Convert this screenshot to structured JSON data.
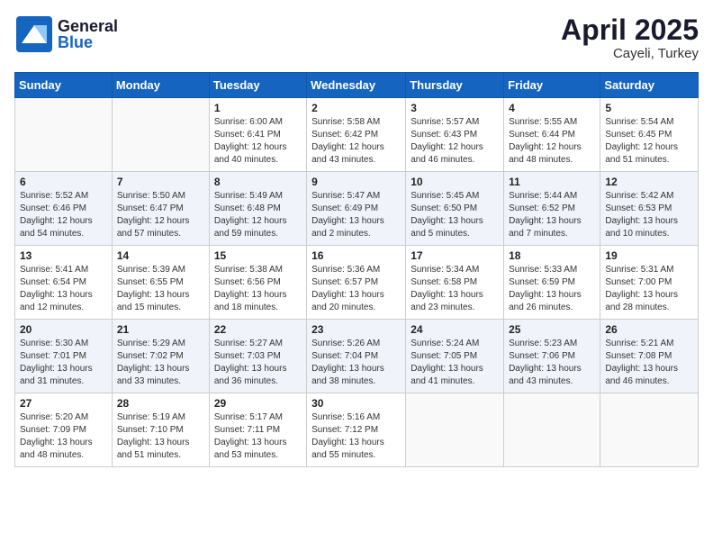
{
  "header": {
    "logo_general": "General",
    "logo_blue": "Blue",
    "month_year": "April 2025",
    "location": "Cayeli, Turkey"
  },
  "weekdays": [
    "Sunday",
    "Monday",
    "Tuesday",
    "Wednesday",
    "Thursday",
    "Friday",
    "Saturday"
  ],
  "weeks": [
    [
      {
        "day": "",
        "info": ""
      },
      {
        "day": "",
        "info": ""
      },
      {
        "day": "1",
        "info": "Sunrise: 6:00 AM\nSunset: 6:41 PM\nDaylight: 12 hours and 40 minutes."
      },
      {
        "day": "2",
        "info": "Sunrise: 5:58 AM\nSunset: 6:42 PM\nDaylight: 12 hours and 43 minutes."
      },
      {
        "day": "3",
        "info": "Sunrise: 5:57 AM\nSunset: 6:43 PM\nDaylight: 12 hours and 46 minutes."
      },
      {
        "day": "4",
        "info": "Sunrise: 5:55 AM\nSunset: 6:44 PM\nDaylight: 12 hours and 48 minutes."
      },
      {
        "day": "5",
        "info": "Sunrise: 5:54 AM\nSunset: 6:45 PM\nDaylight: 12 hours and 51 minutes."
      }
    ],
    [
      {
        "day": "6",
        "info": "Sunrise: 5:52 AM\nSunset: 6:46 PM\nDaylight: 12 hours and 54 minutes."
      },
      {
        "day": "7",
        "info": "Sunrise: 5:50 AM\nSunset: 6:47 PM\nDaylight: 12 hours and 57 minutes."
      },
      {
        "day": "8",
        "info": "Sunrise: 5:49 AM\nSunset: 6:48 PM\nDaylight: 12 hours and 59 minutes."
      },
      {
        "day": "9",
        "info": "Sunrise: 5:47 AM\nSunset: 6:49 PM\nDaylight: 13 hours and 2 minutes."
      },
      {
        "day": "10",
        "info": "Sunrise: 5:45 AM\nSunset: 6:50 PM\nDaylight: 13 hours and 5 minutes."
      },
      {
        "day": "11",
        "info": "Sunrise: 5:44 AM\nSunset: 6:52 PM\nDaylight: 13 hours and 7 minutes."
      },
      {
        "day": "12",
        "info": "Sunrise: 5:42 AM\nSunset: 6:53 PM\nDaylight: 13 hours and 10 minutes."
      }
    ],
    [
      {
        "day": "13",
        "info": "Sunrise: 5:41 AM\nSunset: 6:54 PM\nDaylight: 13 hours and 12 minutes."
      },
      {
        "day": "14",
        "info": "Sunrise: 5:39 AM\nSunset: 6:55 PM\nDaylight: 13 hours and 15 minutes."
      },
      {
        "day": "15",
        "info": "Sunrise: 5:38 AM\nSunset: 6:56 PM\nDaylight: 13 hours and 18 minutes."
      },
      {
        "day": "16",
        "info": "Sunrise: 5:36 AM\nSunset: 6:57 PM\nDaylight: 13 hours and 20 minutes."
      },
      {
        "day": "17",
        "info": "Sunrise: 5:34 AM\nSunset: 6:58 PM\nDaylight: 13 hours and 23 minutes."
      },
      {
        "day": "18",
        "info": "Sunrise: 5:33 AM\nSunset: 6:59 PM\nDaylight: 13 hours and 26 minutes."
      },
      {
        "day": "19",
        "info": "Sunrise: 5:31 AM\nSunset: 7:00 PM\nDaylight: 13 hours and 28 minutes."
      }
    ],
    [
      {
        "day": "20",
        "info": "Sunrise: 5:30 AM\nSunset: 7:01 PM\nDaylight: 13 hours and 31 minutes."
      },
      {
        "day": "21",
        "info": "Sunrise: 5:29 AM\nSunset: 7:02 PM\nDaylight: 13 hours and 33 minutes."
      },
      {
        "day": "22",
        "info": "Sunrise: 5:27 AM\nSunset: 7:03 PM\nDaylight: 13 hours and 36 minutes."
      },
      {
        "day": "23",
        "info": "Sunrise: 5:26 AM\nSunset: 7:04 PM\nDaylight: 13 hours and 38 minutes."
      },
      {
        "day": "24",
        "info": "Sunrise: 5:24 AM\nSunset: 7:05 PM\nDaylight: 13 hours and 41 minutes."
      },
      {
        "day": "25",
        "info": "Sunrise: 5:23 AM\nSunset: 7:06 PM\nDaylight: 13 hours and 43 minutes."
      },
      {
        "day": "26",
        "info": "Sunrise: 5:21 AM\nSunset: 7:08 PM\nDaylight: 13 hours and 46 minutes."
      }
    ],
    [
      {
        "day": "27",
        "info": "Sunrise: 5:20 AM\nSunset: 7:09 PM\nDaylight: 13 hours and 48 minutes."
      },
      {
        "day": "28",
        "info": "Sunrise: 5:19 AM\nSunset: 7:10 PM\nDaylight: 13 hours and 51 minutes."
      },
      {
        "day": "29",
        "info": "Sunrise: 5:17 AM\nSunset: 7:11 PM\nDaylight: 13 hours and 53 minutes."
      },
      {
        "day": "30",
        "info": "Sunrise: 5:16 AM\nSunset: 7:12 PM\nDaylight: 13 hours and 55 minutes."
      },
      {
        "day": "",
        "info": ""
      },
      {
        "day": "",
        "info": ""
      },
      {
        "day": "",
        "info": ""
      }
    ]
  ]
}
